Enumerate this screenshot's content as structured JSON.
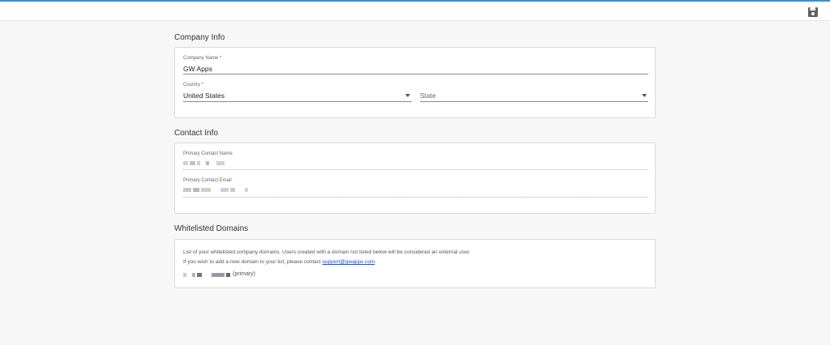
{
  "toolbar": {
    "save_icon": "save-icon"
  },
  "company": {
    "title": "Company Info",
    "name_label": "Company Name *",
    "name_value": "GW Apps",
    "country_label": "Country *",
    "country_value": "United States",
    "state_placeholder": "State"
  },
  "contact": {
    "title": "Contact Info",
    "name_label": "Primary Contact Name",
    "email_label": "Primary Contact Email"
  },
  "domains": {
    "title": "Whitelisted Domains",
    "help_line1": "List of your whitelisted company domains. Users created with a domain not listed below will be considered an external user.",
    "help_line2_prefix": "If you wish to add a new domain to your list, please contact ",
    "support_email": "support@gwapps.com",
    "help_line2_suffix": ".",
    "primary_tag": "(primary)"
  },
  "colors": {
    "accent": "#3f8ed8",
    "link": "#1a4fd6"
  }
}
